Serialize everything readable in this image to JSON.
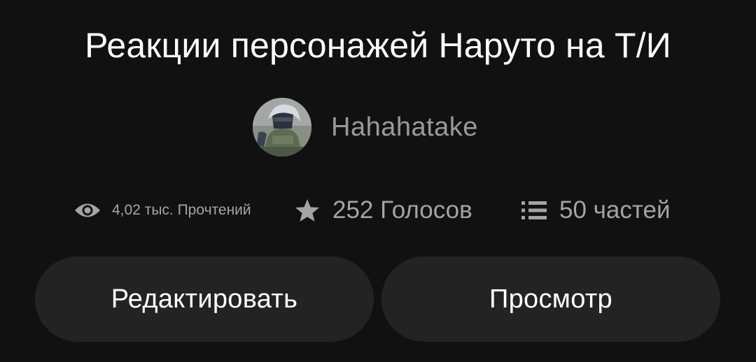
{
  "story": {
    "title": "Реакции персонажей Наруто на Т/И"
  },
  "author": {
    "name": "Hahahatake"
  },
  "stats": {
    "reads": {
      "icon": "eye-icon",
      "label": "4,02 тыс. Прочтений"
    },
    "votes": {
      "icon": "star-icon",
      "label": "252 Голосов"
    },
    "parts": {
      "icon": "list-icon",
      "label": "50 частей"
    }
  },
  "actions": {
    "edit_label": "Редактировать",
    "view_label": "Просмотр"
  },
  "colors": {
    "background": "#121112",
    "button": "#242324",
    "text_primary": "#ffffff",
    "text_secondary": "#a4a4a4"
  }
}
